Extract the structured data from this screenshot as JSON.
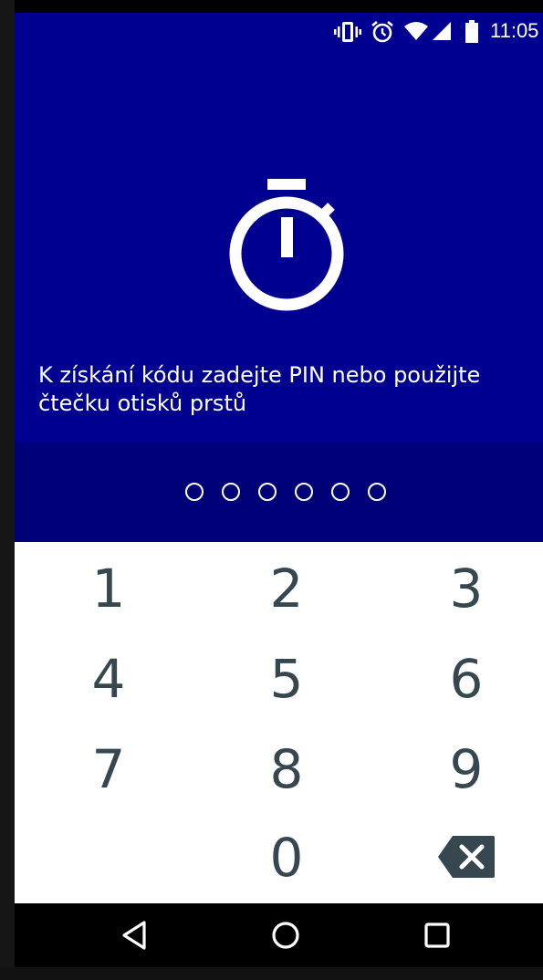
{
  "status_bar": {
    "time": "11:05",
    "icons": [
      "vibrate-icon",
      "alarm-icon",
      "wifi-icon",
      "cellular-signal-icon",
      "battery-icon"
    ]
  },
  "header": {
    "icon": "stopwatch-icon",
    "prompt": "K získání kódu zadejte PIN nebo použijte čtečku otisků prstů",
    "background_color": "#000090"
  },
  "pin": {
    "length": 6,
    "entered": 0
  },
  "keypad": {
    "keys": [
      "1",
      "2",
      "3",
      "4",
      "5",
      "6",
      "7",
      "8",
      "9",
      "0"
    ],
    "delete_icon": "backspace-icon",
    "text_color": "#37474f"
  },
  "nav_bar": {
    "buttons": [
      "back-icon",
      "home-icon",
      "recents-icon"
    ]
  }
}
